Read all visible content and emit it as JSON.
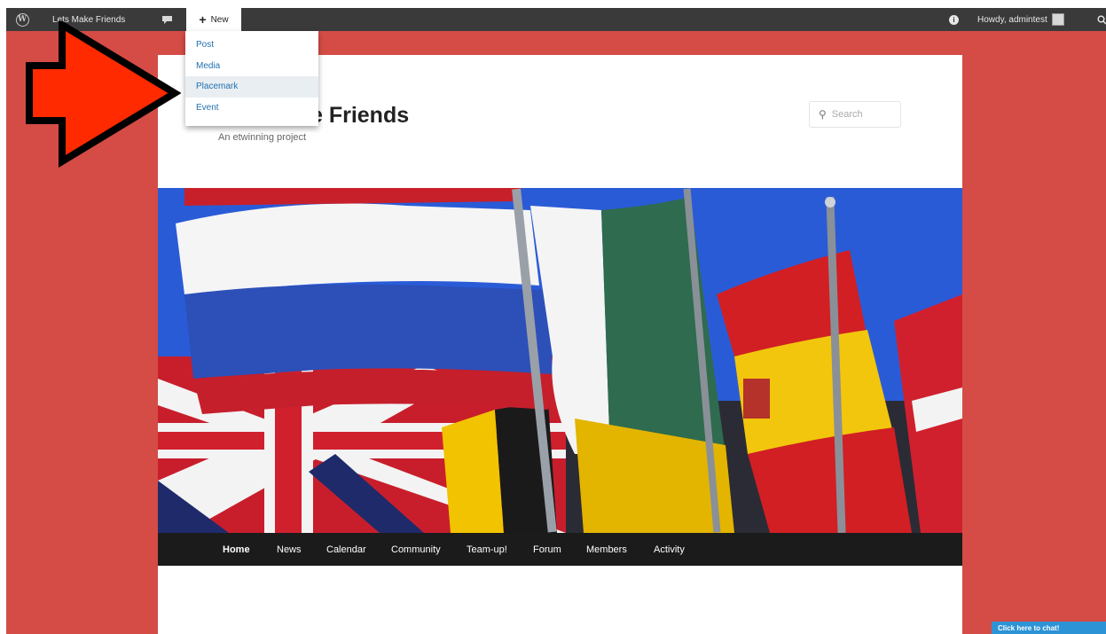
{
  "adminbar": {
    "site_name": "Lets Make Friends",
    "new_label": "New",
    "howdy": "Howdy, admintest",
    "icons": [
      "wordpress-logo-icon",
      "comment-icon",
      "plus-icon",
      "info-icon",
      "avatar",
      "search-icon"
    ]
  },
  "new_menu": {
    "items": [
      {
        "label": "Post"
      },
      {
        "label": "Media"
      },
      {
        "label": "Placemark",
        "highlighted": true
      },
      {
        "label": "Event"
      }
    ]
  },
  "site": {
    "title": "Lets Make Friends",
    "tagline": "An etwinning project",
    "search_placeholder": "Search"
  },
  "nav": {
    "items": [
      {
        "label": "Home",
        "active": true
      },
      {
        "label": "News"
      },
      {
        "label": "Calendar"
      },
      {
        "label": "Community"
      },
      {
        "label": "Team-up!"
      },
      {
        "label": "Forum"
      },
      {
        "label": "Members"
      },
      {
        "label": "Activity"
      }
    ]
  },
  "chat": {
    "label": "Click here to chat!"
  },
  "colors": {
    "background": "#d44c45",
    "admin_bar": "#3a3a3a",
    "link": "#2271b1",
    "nav_bar": "#1b1b1b",
    "arrow": "#ff2a00"
  }
}
